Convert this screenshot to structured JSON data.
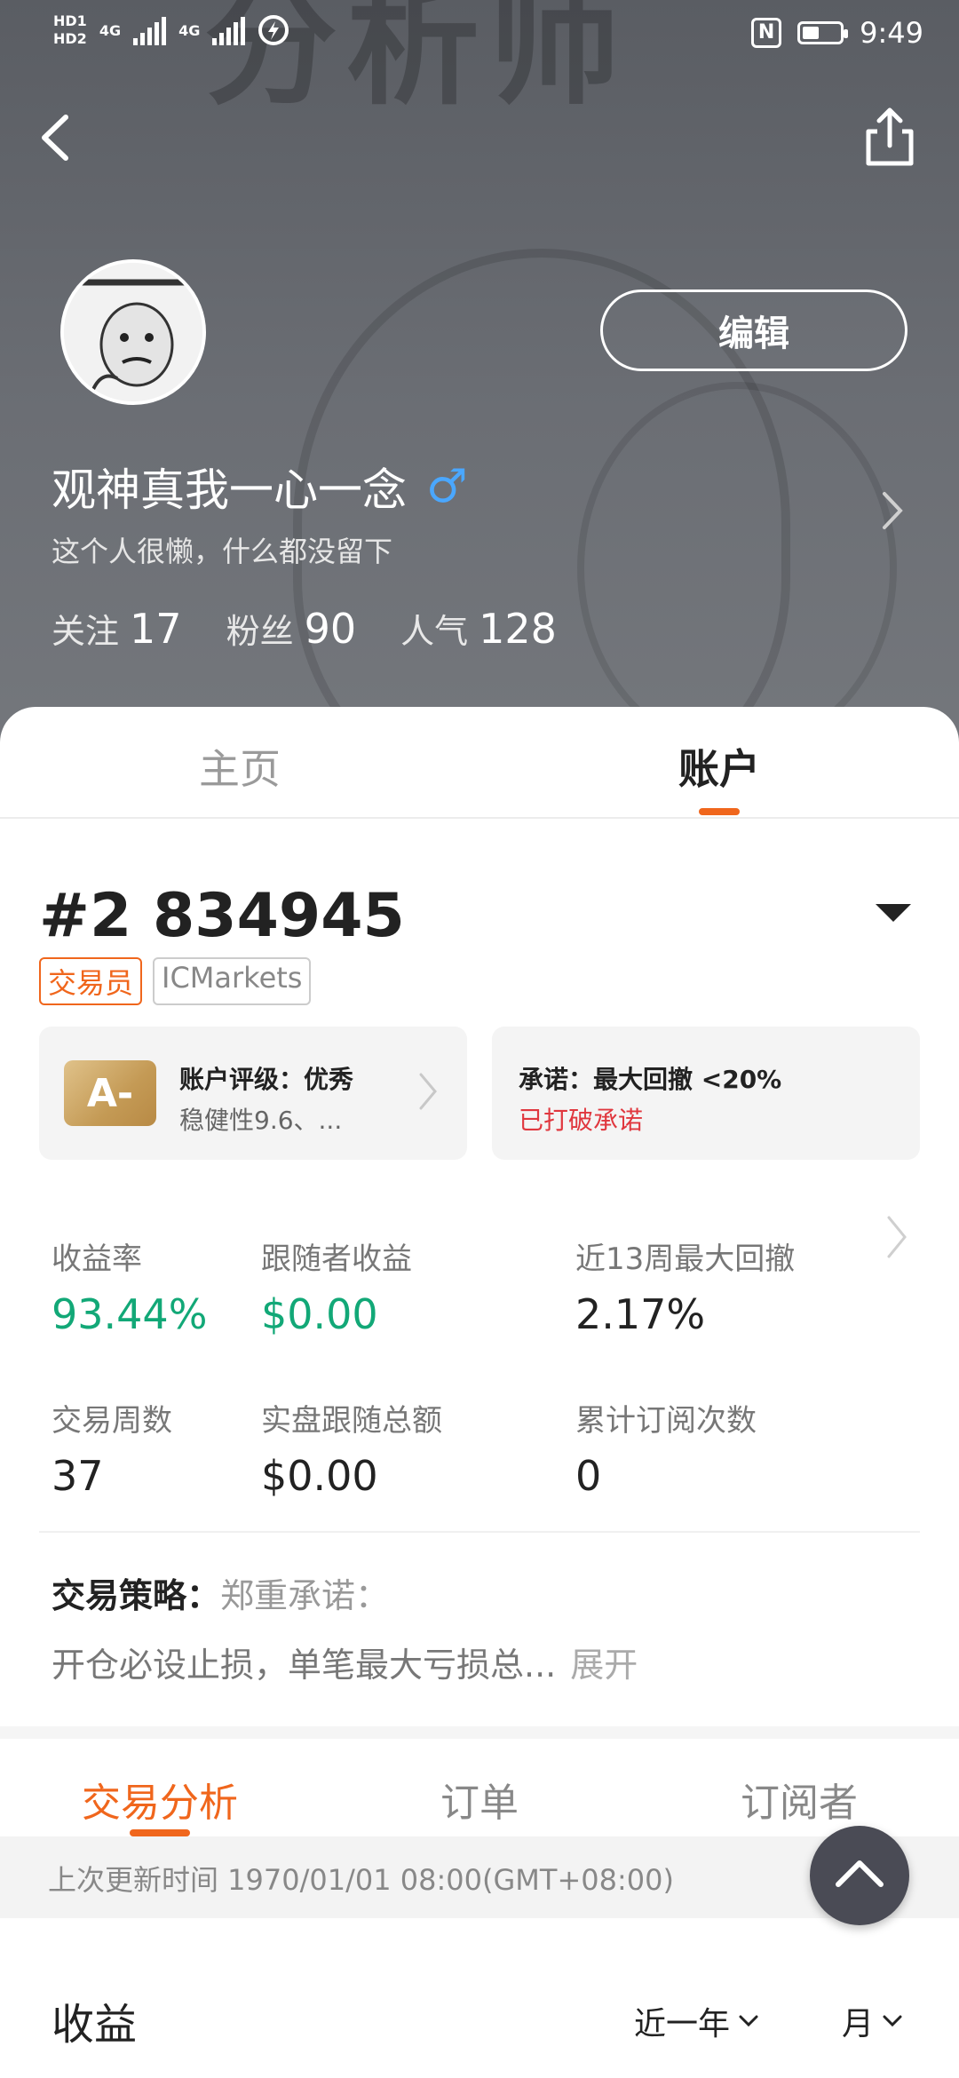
{
  "status_bar": {
    "signal_labels": [
      "HD1",
      "HD2"
    ],
    "network_1": "4G",
    "network_2": "4G",
    "time": "9:49",
    "battery_level": 0.45,
    "nfc_label": "N"
  },
  "header": {
    "cover_text": "分析师",
    "edit_label": "编辑",
    "username": "观神真我一心一念",
    "gender_symbol": "♂",
    "bio": "这个人很懒，什么都没留下",
    "stats": [
      {
        "label": "关注",
        "value": "17"
      },
      {
        "label": "粉丝",
        "value": "90"
      },
      {
        "label": "人气",
        "value": "128"
      }
    ]
  },
  "main_tabs": [
    {
      "label": "主页",
      "active": false
    },
    {
      "label": "账户",
      "active": true
    }
  ],
  "account": {
    "id": "#2 834945",
    "tags": [
      "交易员",
      "ICMarkets"
    ],
    "rating_card": {
      "badge": "A-",
      "title": "账户评级：优秀",
      "subtitle": "稳健性9.6、..."
    },
    "promise_card": {
      "title": "承诺：最大回撤 <20%",
      "subtitle": "已打破承诺"
    },
    "metrics": [
      {
        "label": "收益率",
        "value": "93.44%",
        "color": "#12a877"
      },
      {
        "label": "跟随者收益",
        "value": "$0.00",
        "color": "#12a877"
      },
      {
        "label": "近13周最大回撤",
        "value": "2.17%",
        "color": "#222222"
      },
      {
        "label": "交易周数",
        "value": "37",
        "color": "#222222"
      },
      {
        "label": "实盘跟随总额",
        "value": "$0.00",
        "color": "#222222"
      },
      {
        "label": "累计订阅次数",
        "value": "0",
        "color": "#222222"
      }
    ],
    "strategy": {
      "label": "交易策略：",
      "head": "郑重承诺：",
      "body": "开仓必设止损，单笔最大亏损总...",
      "expand": "展开"
    }
  },
  "sub_tabs": [
    {
      "label": "交易分析",
      "active": true
    },
    {
      "label": "订单",
      "active": false
    },
    {
      "label": "订阅者",
      "active": false
    }
  ],
  "update": {
    "text": "上次更新时间 1970/01/01 08:00(GMT+08:00)"
  },
  "earnings": {
    "title": "收益",
    "period": "近一年",
    "unit": "月"
  },
  "colors": {
    "accent": "#f0661c",
    "positive": "#12a877",
    "negative": "#e0373e",
    "gender": "#4aa7ff"
  }
}
